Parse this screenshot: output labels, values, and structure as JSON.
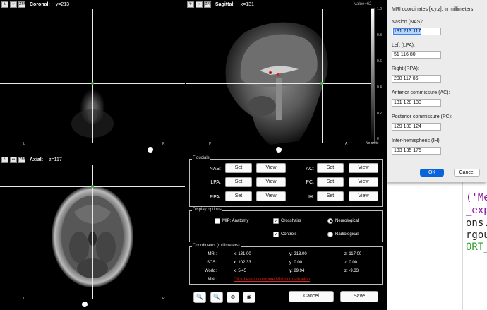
{
  "editor": {
    "lines": [
      "('Me",
      "_exp",
      "ons.",
      "rgou",
      "ORT_"
    ],
    "colors": [
      "#8a1a9e",
      "#8a1a9e",
      "#222222",
      "#222222",
      "#2aa02a"
    ]
  },
  "viewer": {
    "toolbar_buttons": {
      "rotate": "↻",
      "flip": "↔",
      "zoom": "ZFF"
    },
    "coronal": {
      "title": "Coronal:",
      "coord": "y=213",
      "left_label": "L",
      "right_label": "R"
    },
    "sagittal": {
      "title": "Sagittal:",
      "coord": "x=131",
      "left_label": "P",
      "right_label": "A"
    },
    "axial": {
      "title": "Axial:",
      "coord": "z=117",
      "left_label": "L",
      "right_label": "R"
    },
    "value_readout": "value=62",
    "colorbar": {
      "top": "1.0",
      "ticks": [
        "0.8",
        "0.6",
        "0.4",
        "0.2",
        "0"
      ],
      "units": "No units"
    }
  },
  "fiducials": {
    "title": "Fiducials",
    "set_label": "Set",
    "view_label": "View",
    "left": [
      "NAS:",
      "LPA:",
      "RPA:"
    ],
    "right": [
      "AC:",
      "PC:",
      "IH:"
    ]
  },
  "display": {
    "title": "Display options",
    "mip": "MIP: Anatomy",
    "crosshairs": "Crosshairs",
    "controls": "Controls",
    "neurological": "Neurological",
    "radiological": "Radiological",
    "mip_checked": false,
    "crosshairs_checked": true,
    "controls_checked": true,
    "orientation": "neurological"
  },
  "coords": {
    "title": "Coordinates (millimeters)",
    "rows": [
      {
        "label": "MRI:",
        "x": "x: 131.00",
        "y": "y: 213.00",
        "z": "z: 117.00"
      },
      {
        "label": "SCS:",
        "x": "x: 102.33",
        "y": "y: 0.00",
        "z": "z: 0.00"
      },
      {
        "label": "World:",
        "x": "x: 5.45",
        "y": "y: 89.94",
        "z": "z: -9.33"
      }
    ],
    "mni_label": "MNI:",
    "mni_link": "Click here to compute MNI normalization"
  },
  "bottom": {
    "zoom_in": "🔍",
    "zoom_out": "🔍",
    "target": "⊕",
    "pin": "◉",
    "cancel": "Cancel",
    "save": "Save"
  },
  "dialog": {
    "heading": "MRI coordinates [x,y,z], in millimeters:",
    "fields": [
      {
        "label": "Nasion (NAS):",
        "value": "131  213  117"
      },
      {
        "label": "Left (LPA):",
        "value": "51  116  80"
      },
      {
        "label": "Right (RPA):",
        "value": "208  117  86"
      },
      {
        "label": "Anterior commissure (AC):",
        "value": "131  128  130"
      },
      {
        "label": "Posterior commissure (PC):",
        "value": "129  103  124"
      },
      {
        "label": "Inter-hemispheric (IH):",
        "value": "133  135  176"
      }
    ],
    "ok": "OK",
    "cancel": "Cancel"
  }
}
